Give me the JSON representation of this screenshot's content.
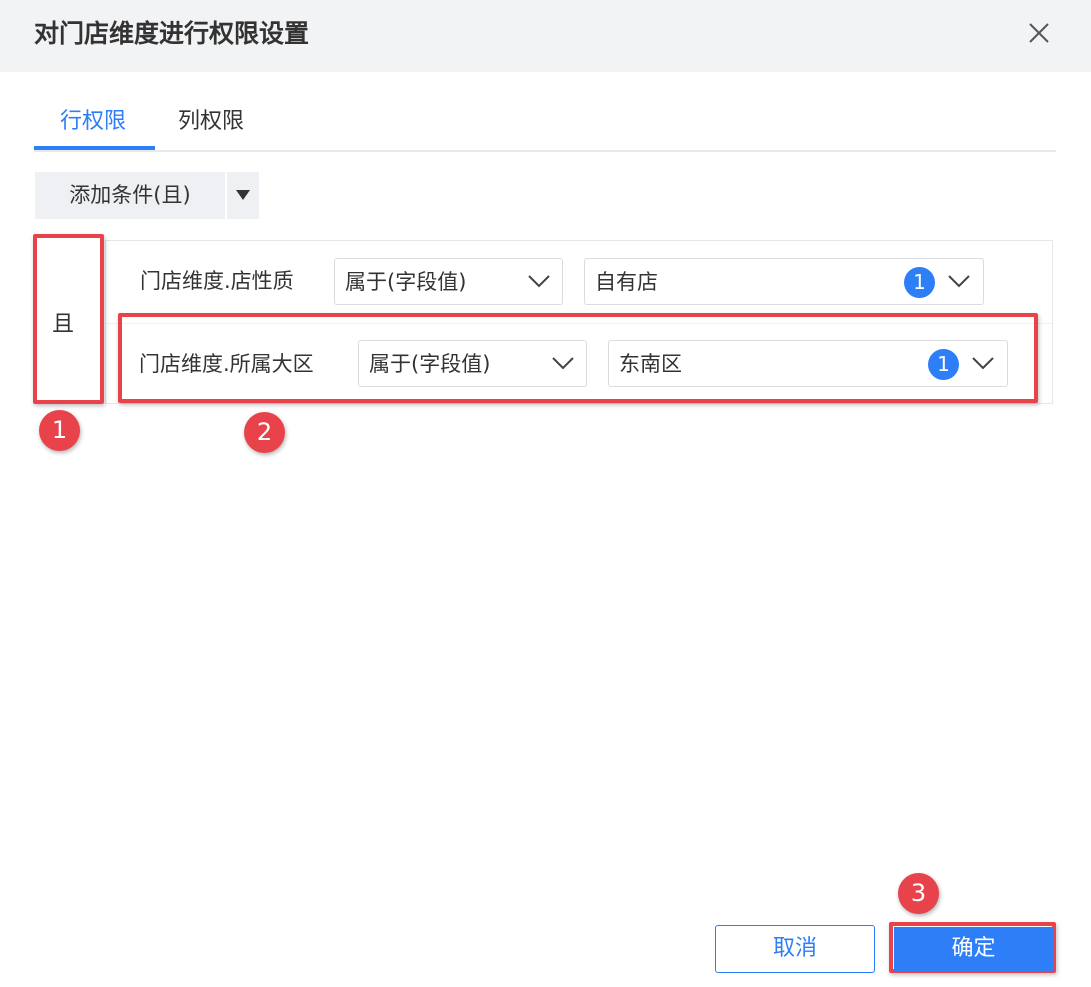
{
  "dialog": {
    "title": "对门店维度进行权限设置",
    "close_icon": "close-icon"
  },
  "tabs": [
    {
      "label": "行权限",
      "active": true
    },
    {
      "label": "列权限",
      "active": false
    }
  ],
  "toolbar": {
    "add_condition_label": "添加条件(且)",
    "dropdown_icon": "caret-down-icon"
  },
  "conditions": {
    "logic_label": "且",
    "rows": [
      {
        "field": "门店维度.店性质",
        "operator": "属于(字段值)",
        "value": "自有店",
        "count": "1"
      },
      {
        "field": "门店维度.所属大区",
        "operator": "属于(字段值)",
        "value": "东南区",
        "count": "1"
      }
    ]
  },
  "annotations": {
    "step1": "1",
    "step2": "2",
    "step3": "3",
    "highlight_color": "#e8424b"
  },
  "footer": {
    "cancel_label": "取消",
    "ok_label": "确定"
  },
  "colors": {
    "accent": "#2d7ef7",
    "header_bg": "#f2f3f5"
  }
}
